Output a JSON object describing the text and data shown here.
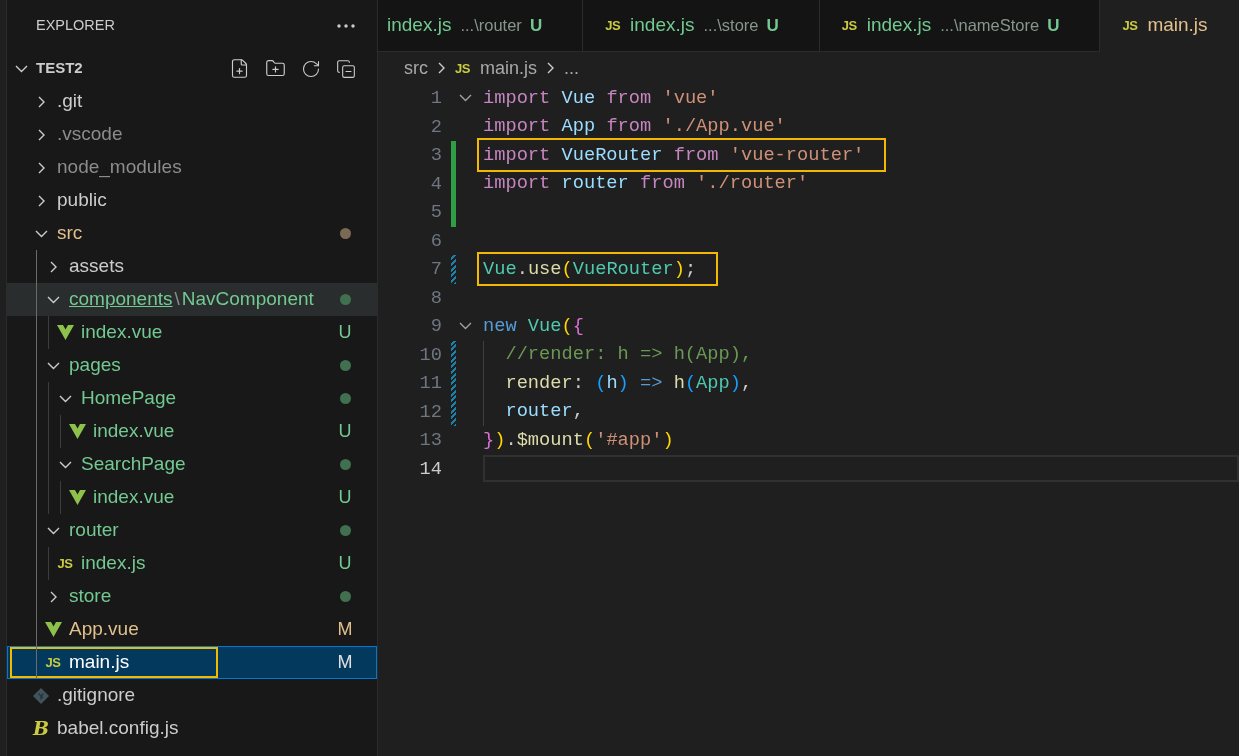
{
  "explorer": {
    "title": "EXPLORER",
    "root": {
      "name": "TEST2",
      "expanded": true
    },
    "tree": [
      {
        "name": ".git",
        "kind": "folder",
        "expanded": false,
        "selected": false,
        "hovered": false,
        "highlighted": false
      },
      {
        "name": ".vscode",
        "kind": "folder",
        "expanded": false,
        "color": "#8c8c8c",
        "selected": false,
        "hovered": false,
        "highlighted": false
      },
      {
        "name": "node_modules",
        "kind": "folder",
        "expanded": false,
        "color": "#8c8c8c",
        "selected": false,
        "hovered": false,
        "highlighted": false
      },
      {
        "name": "public",
        "kind": "folder",
        "expanded": false,
        "selected": false,
        "hovered": false,
        "highlighted": false
      },
      {
        "name": "src",
        "kind": "folder",
        "expanded": true,
        "color": "#e2c08d",
        "dot": {
          "color": "#7a6a55"
        },
        "selected": false,
        "hovered": false,
        "highlighted": false,
        "children": [
          {
            "name": "assets",
            "kind": "folder",
            "expanded": false,
            "selected": false,
            "hovered": false,
            "highlighted": false
          },
          {
            "name": "components",
            "compact": [
              {
                "separator": "\\",
                "name": "NavComponent"
              }
            ],
            "kind": "folder",
            "expanded": true,
            "color": "#73c991",
            "dot": {
              "color": "#41704f"
            },
            "selected": false,
            "hovered": true,
            "highlighted": false,
            "children": [
              {
                "name": "index.vue",
                "kind": "vue",
                "color": "#73c991",
                "badge": "U",
                "selected": false,
                "hovered": false,
                "highlighted": false
              }
            ]
          },
          {
            "name": "pages",
            "kind": "folder",
            "expanded": true,
            "color": "#73c991",
            "dot": {
              "color": "#41704f"
            },
            "selected": false,
            "hovered": false,
            "highlighted": false,
            "children": [
              {
                "name": "HomePage",
                "kind": "folder",
                "expanded": true,
                "color": "#73c991",
                "dot": {
                  "color": "#41704f"
                },
                "selected": false,
                "hovered": false,
                "highlighted": false,
                "children": [
                  {
                    "name": "index.vue",
                    "kind": "vue",
                    "color": "#73c991",
                    "badge": "U",
                    "selected": false,
                    "hovered": false,
                    "highlighted": false
                  }
                ]
              },
              {
                "name": "SearchPage",
                "kind": "folder",
                "expanded": true,
                "color": "#73c991",
                "dot": {
                  "color": "#41704f"
                },
                "selected": false,
                "hovered": false,
                "highlighted": false,
                "children": [
                  {
                    "name": "index.vue",
                    "kind": "vue",
                    "color": "#73c991",
                    "badge": "U",
                    "selected": false,
                    "hovered": false,
                    "highlighted": false
                  }
                ]
              }
            ]
          },
          {
            "name": "router",
            "kind": "folder",
            "expanded": true,
            "color": "#73c991",
            "dot": {
              "color": "#41704f"
            },
            "selected": false,
            "hovered": false,
            "highlighted": false,
            "children": [
              {
                "name": "index.js",
                "kind": "js",
                "icon_text": "JS",
                "color": "#73c991",
                "badge": "U",
                "selected": false,
                "hovered": false,
                "highlighted": false
              }
            ]
          },
          {
            "name": "store",
            "kind": "folder",
            "expanded": false,
            "color": "#73c991",
            "dot": {
              "color": "#41704f"
            },
            "selected": false,
            "hovered": false,
            "highlighted": false
          },
          {
            "name": "App.vue",
            "kind": "vue",
            "color": "#e2c08d",
            "badge": "M",
            "selected": false,
            "hovered": false,
            "highlighted": false
          },
          {
            "name": "main.js",
            "kind": "js",
            "icon_text": "JS",
            "badge": "M",
            "selected": true,
            "hovered": false,
            "highlighted": true
          }
        ]
      },
      {
        "name": ".gitignore",
        "kind": "git",
        "selected": false,
        "hovered": false,
        "highlighted": false
      },
      {
        "name": "babel.config.js",
        "kind": "babel",
        "icon_text": "B",
        "selected": false,
        "hovered": false,
        "highlighted": false
      }
    ]
  },
  "tabs": [
    {
      "name": "index.js",
      "description": "...\\router",
      "badge": "U",
      "color": "#73c991",
      "selected": false
    },
    {
      "kind": "js",
      "icon_text": "JS",
      "name": "index.js",
      "description": "...\\store",
      "badge": "U",
      "color": "#73c991",
      "selected": false
    },
    {
      "kind": "js",
      "icon_text": "JS",
      "name": "index.js",
      "description": "...\\nameStore",
      "badge": "U",
      "color": "#73c991",
      "selected": false
    },
    {
      "kind": "js",
      "icon_text": "JS",
      "name": "main.js",
      "color": "#e2c08d",
      "selected": true
    }
  ],
  "breadcrumb": [
    {
      "label": "src"
    },
    {
      "label": "main.js",
      "kind": "js",
      "icon_text": "JS"
    },
    {
      "label": "..."
    }
  ],
  "editor": {
    "lines": [
      {
        "number": "1",
        "foldable": true,
        "added": false,
        "modified": false,
        "current": false,
        "highlighted": false,
        "indented": false,
        "tokens": [
          {
            "text": "import ",
            "kind": "keyword"
          },
          {
            "text": "Vue ",
            "kind": "variable"
          },
          {
            "text": "from ",
            "kind": "keyword"
          },
          {
            "text": "'vue'",
            "kind": "string"
          }
        ]
      },
      {
        "number": "2",
        "foldable": false,
        "added": false,
        "modified": false,
        "current": false,
        "highlighted": false,
        "indented": false,
        "tokens": [
          {
            "text": "import ",
            "kind": "keyword"
          },
          {
            "text": "App ",
            "kind": "variable"
          },
          {
            "text": "from ",
            "kind": "keyword"
          },
          {
            "text": "'./App.vue'",
            "kind": "string"
          }
        ]
      },
      {
        "number": "3",
        "foldable": false,
        "added": true,
        "modified": false,
        "current": false,
        "highlighted": true,
        "indented": false,
        "tokens": [
          {
            "text": "import ",
            "kind": "keyword"
          },
          {
            "text": "VueRouter ",
            "kind": "variable"
          },
          {
            "text": "from ",
            "kind": "keyword"
          },
          {
            "text": "'vue-router'",
            "kind": "string"
          }
        ]
      },
      {
        "number": "4",
        "foldable": false,
        "added": true,
        "modified": false,
        "current": false,
        "highlighted": false,
        "indented": false,
        "tokens": [
          {
            "text": "import ",
            "kind": "keyword"
          },
          {
            "text": "router ",
            "kind": "variable"
          },
          {
            "text": "from ",
            "kind": "keyword"
          },
          {
            "text": "'./router'",
            "kind": "string"
          }
        ]
      },
      {
        "number": "5",
        "foldable": false,
        "added": true,
        "modified": false,
        "current": false,
        "highlighted": false
      },
      {
        "number": "6",
        "foldable": false,
        "added": false,
        "modified": false,
        "current": false,
        "highlighted": false
      },
      {
        "number": "7",
        "foldable": false,
        "added": false,
        "modified": true,
        "current": false,
        "highlighted": true,
        "indented": false,
        "tokens": [
          {
            "text": "Vue",
            "kind": "class"
          },
          {
            "text": ".",
            "kind": "plain"
          },
          {
            "text": "use",
            "kind": "function"
          },
          {
            "text": "(",
            "kind": "bracket_gold"
          },
          {
            "text": "VueRouter",
            "kind": "class"
          },
          {
            "text": ")",
            "kind": "bracket_gold"
          },
          {
            "text": ";",
            "kind": "plain"
          }
        ]
      },
      {
        "number": "8",
        "foldable": false,
        "added": false,
        "modified": false,
        "current": false,
        "highlighted": false
      },
      {
        "number": "9",
        "foldable": true,
        "added": false,
        "modified": false,
        "current": false,
        "highlighted": false,
        "indented": false,
        "tokens": [
          {
            "text": "new ",
            "kind": "storage"
          },
          {
            "text": "Vue",
            "kind": "class"
          },
          {
            "text": "(",
            "kind": "bracket_gold"
          },
          {
            "text": "{",
            "kind": "bracket_orchid"
          }
        ]
      },
      {
        "number": "10",
        "foldable": false,
        "added": false,
        "modified": true,
        "current": false,
        "highlighted": false,
        "indented": true,
        "tokens": [
          {
            "text": "//render: h => h(App),",
            "kind": "comment"
          }
        ]
      },
      {
        "number": "11",
        "foldable": false,
        "added": false,
        "modified": true,
        "current": false,
        "highlighted": false,
        "indented": true,
        "tokens": [
          {
            "text": "render",
            "kind": "function"
          },
          {
            "text": ": ",
            "kind": "plain"
          },
          {
            "text": "(",
            "kind": "bracket_blue"
          },
          {
            "text": "h",
            "kind": "variable"
          },
          {
            "text": ")",
            "kind": "bracket_blue"
          },
          {
            "text": " => ",
            "kind": "storage"
          },
          {
            "text": "h",
            "kind": "function"
          },
          {
            "text": "(",
            "kind": "bracket_blue"
          },
          {
            "text": "App",
            "kind": "class"
          },
          {
            "text": ")",
            "kind": "bracket_blue"
          },
          {
            "text": ",",
            "kind": "plain"
          }
        ]
      },
      {
        "number": "12",
        "foldable": false,
        "added": false,
        "modified": true,
        "current": false,
        "highlighted": false,
        "indented": true,
        "tokens": [
          {
            "text": "router",
            "kind": "variable"
          },
          {
            "text": ",",
            "kind": "plain"
          }
        ]
      },
      {
        "number": "13",
        "foldable": false,
        "added": false,
        "modified": false,
        "current": false,
        "highlighted": false,
        "indented": false,
        "tokens": [
          {
            "text": "}",
            "kind": "bracket_orchid"
          },
          {
            "text": ")",
            "kind": "bracket_gold"
          },
          {
            "text": ".",
            "kind": "plain"
          },
          {
            "text": "$mount",
            "kind": "function"
          },
          {
            "text": "(",
            "kind": "bracket_gold"
          },
          {
            "text": "'#app'",
            "kind": "string"
          },
          {
            "text": ")",
            "kind": "bracket_gold"
          }
        ]
      },
      {
        "number": "14",
        "foldable": false,
        "added": false,
        "modified": false,
        "current": true,
        "highlighted": false
      }
    ]
  }
}
